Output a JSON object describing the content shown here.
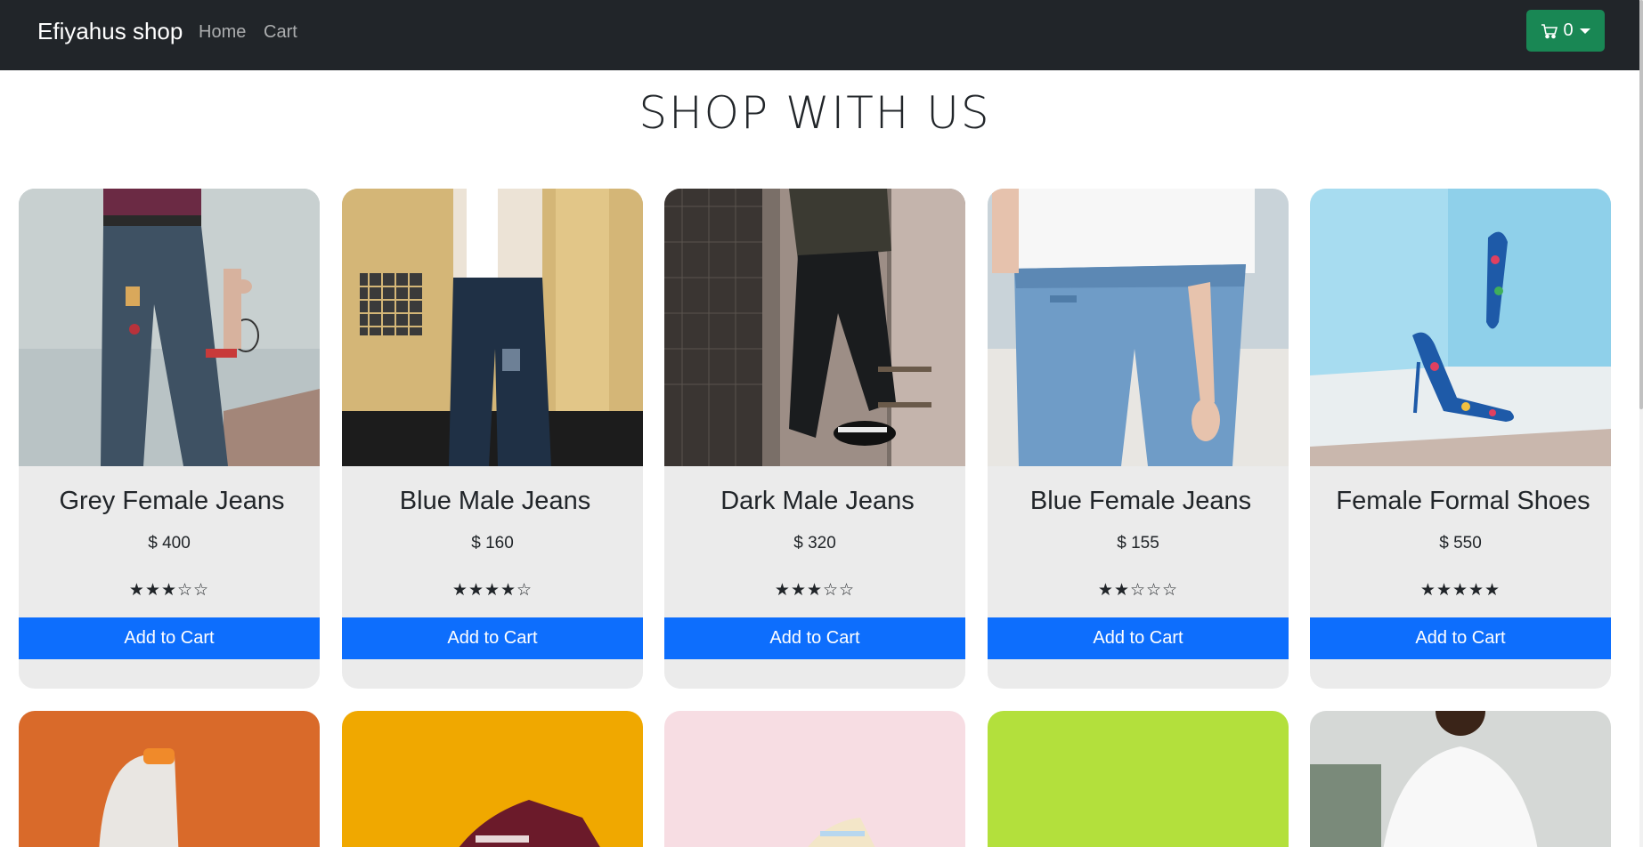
{
  "nav": {
    "brand": "Efiyahus shop",
    "links": [
      "Home",
      "Cart"
    ],
    "cart_count": "0",
    "cart_icon": "cart-icon",
    "cart_color": "#198754"
  },
  "page_title": "SHOP WITH US",
  "products": [
    {
      "title": "Grey Female Jeans",
      "price": "$ 400",
      "stars": "★★★☆☆",
      "rating": 3,
      "button": "Add to Cart"
    },
    {
      "title": "Blue Male Jeans",
      "price": "$ 160",
      "stars": "★★★★☆",
      "rating": 4,
      "button": "Add to Cart"
    },
    {
      "title": "Dark Male Jeans",
      "price": "$ 320",
      "stars": "★★★☆☆",
      "rating": 3,
      "button": "Add to Cart"
    },
    {
      "title": "Blue Female Jeans",
      "price": "$ 155",
      "stars": "★★☆☆☆",
      "rating": 2,
      "button": "Add to Cart"
    },
    {
      "title": "Female Formal Shoes",
      "price": "$ 550",
      "stars": "★★★★★",
      "rating": 5,
      "button": "Add to Cart"
    }
  ],
  "colors": {
    "navbar": "#212529",
    "accent_blue": "#0d6efd",
    "card_bg": "#ebebeb"
  }
}
